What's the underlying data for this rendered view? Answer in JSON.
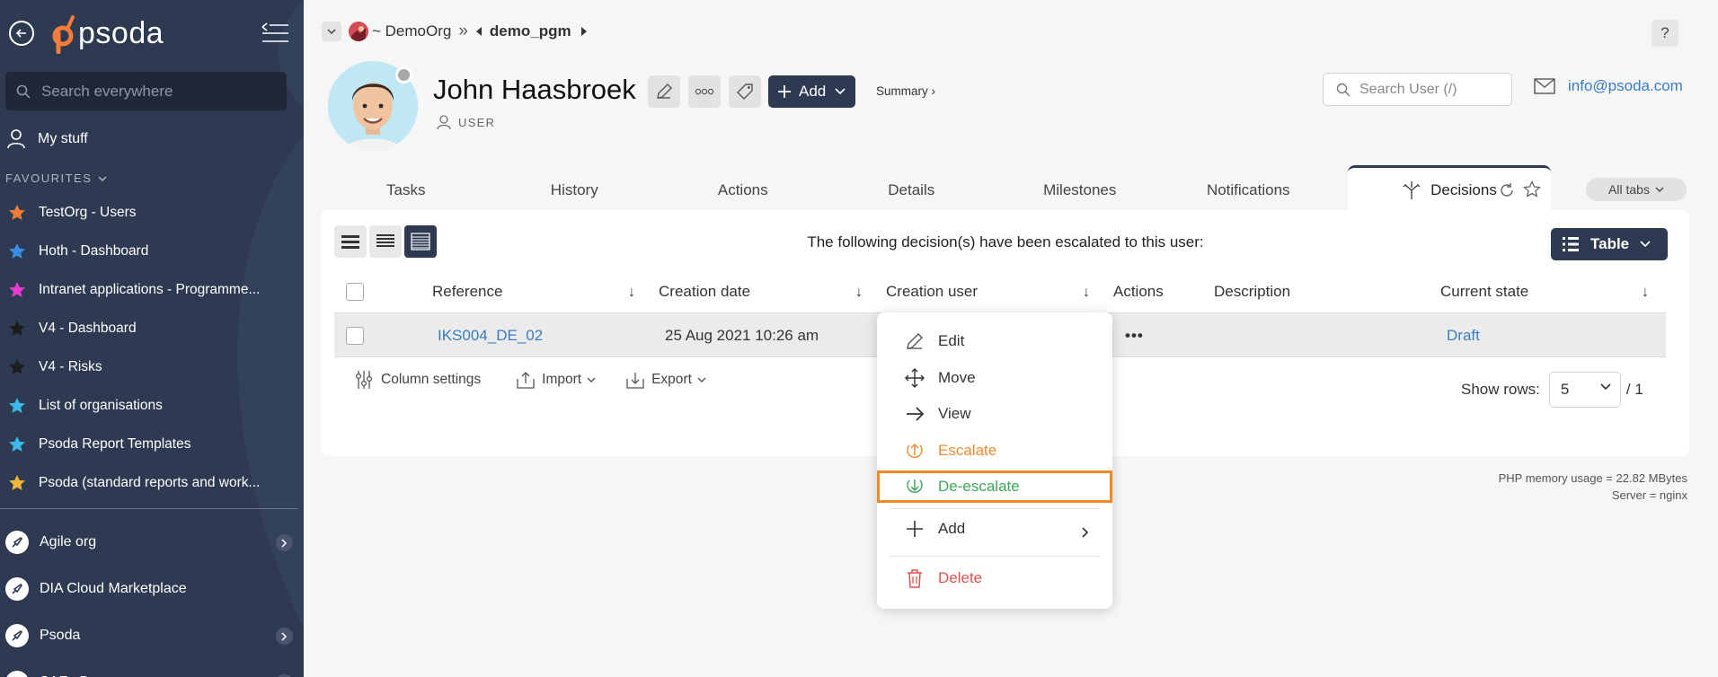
{
  "sidebar": {
    "search_placeholder": "Search everywhere",
    "logo_text": "psoda",
    "my_stuff": "My stuff",
    "favourites_title": "FAVOURITES",
    "favourites": [
      {
        "label": "TestOrg - Users",
        "color": "#f07a3a"
      },
      {
        "label": "Hoth - Dashboard",
        "color": "#3a8ee6"
      },
      {
        "label": "Intranet applications - Programme...",
        "color": "#e63ad2"
      },
      {
        "label": "V4 - Dashboard",
        "color": "#1c1c1c"
      },
      {
        "label": "V4 - Risks",
        "color": "#1c1c1c"
      },
      {
        "label": "List of organisations",
        "color": "#3ab8e6"
      },
      {
        "label": "Psoda Report Templates",
        "color": "#3ab8e6"
      },
      {
        "label": "Psoda (standard reports and work...",
        "color": "#f0b73a"
      }
    ],
    "orgs": [
      {
        "label": "Agile org",
        "has_children": true
      },
      {
        "label": "DIA Cloud Marketplace",
        "has_children": false
      },
      {
        "label": "Psoda",
        "has_children": true
      },
      {
        "label": "SAFe Demo",
        "has_children": true
      }
    ]
  },
  "breadcrumb": {
    "org": "~ DemoOrg",
    "separator": "»",
    "current": "demo_pgm"
  },
  "help_label": "?",
  "user": {
    "name": "John Haasbroek",
    "type": "USER"
  },
  "header": {
    "add_label": "Add",
    "summary_label": "Summary ›",
    "search_placeholder": "Search User (/)",
    "email": "info@psoda.com"
  },
  "tabs": [
    "Tasks",
    "History",
    "Actions",
    "Details",
    "Milestones",
    "Notifications"
  ],
  "active_tab": "Decisions",
  "all_tabs_label": "All tabs",
  "panel": {
    "message": "The following decision(s) have been escalated to this user:",
    "table_button": "Table",
    "columns": [
      "Reference",
      "Creation date",
      "Creation user",
      "Actions",
      "Description",
      "Current state"
    ],
    "rows": [
      {
        "reference": "IKS004_DE_02",
        "creation_date": "25 Aug 2021 10:26 am",
        "creation_user": "",
        "actions": "•••",
        "description": "",
        "current_state": "Draft"
      }
    ],
    "column_settings": "Column settings",
    "import": "Import",
    "export": "Export",
    "show_rows_label": "Show rows:",
    "rows_value": "5",
    "total_pages": "/ 1"
  },
  "php_info": {
    "memory": "PHP memory usage = 22.82 MBytes",
    "server": "Server = nginx"
  },
  "context_menu": {
    "items": [
      {
        "label": "Edit",
        "icon": "pencil-icon",
        "color": "#333333"
      },
      {
        "label": "Move",
        "icon": "move-icon",
        "color": "#333333"
      },
      {
        "label": "View",
        "icon": "arrow-right-icon",
        "color": "#333333"
      },
      {
        "label": "Escalate",
        "icon": "escalate-icon",
        "color": "#ef8a2e"
      },
      {
        "label": "De-escalate",
        "icon": "deescalate-icon",
        "color": "#3aa85a"
      },
      {
        "label": "Add",
        "icon": "plus-icon",
        "color": "#333333"
      },
      {
        "label": "Delete",
        "icon": "trash-icon",
        "color": "#e0524f"
      }
    ],
    "highlight_color": "#f08a24"
  },
  "colors": {
    "sidebar_bg": "#2e3a52",
    "accent": "#2e3a52",
    "link": "#3a7cc2"
  }
}
